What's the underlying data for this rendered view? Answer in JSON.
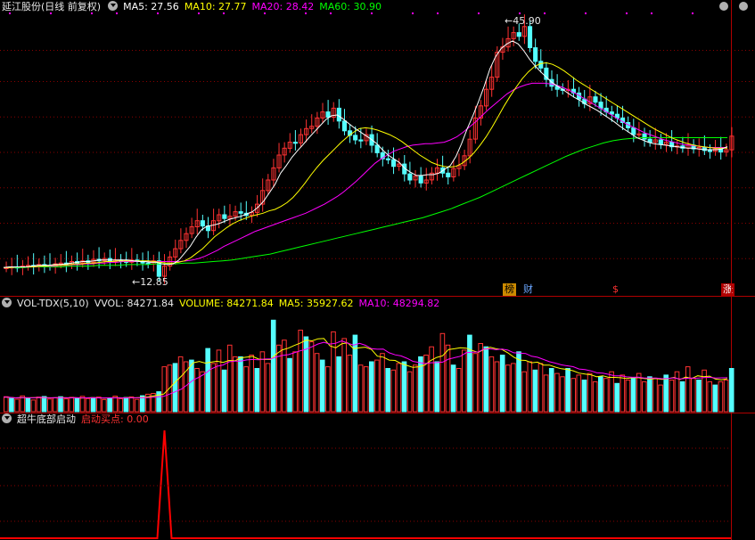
{
  "main": {
    "stock_title": "延江股份(日线 前复权)",
    "ma5_label": "MA5: 27.56",
    "ma10_label": "MA10: 27.77",
    "ma20_label": "MA20: 28.42",
    "ma60_label": "MA60: 30.90",
    "high_label": "45.90",
    "low_label": "12.85",
    "markers": [
      "榜",
      "财",
      "$",
      "涨"
    ]
  },
  "volume": {
    "indicator_label": "VOL-TDX(5,10)",
    "vvol_label": "VVOL: 84271.84",
    "volume_label": "VOLUME: 84271.84",
    "ma5_label": "MA5: 35927.62",
    "ma10_label": "MA10: 48294.82"
  },
  "signal": {
    "indicator_label": "超牛底部启动",
    "value_label": "启动买点: 0.00"
  },
  "colors": {
    "up": "#ff3232",
    "down": "#54ffff",
    "ma5": "#ffffff",
    "ma10": "#ffff00",
    "ma20": "#ff00ff",
    "ma60": "#00ff00",
    "grid": "#8b0000"
  },
  "chart_data": [
    {
      "type": "candlestick",
      "title": "延江股份(日线 前复权)",
      "price_range": [
        10.5,
        48
      ],
      "annotations": [
        {
          "label": "45.90",
          "value": 45.9
        },
        {
          "label": "12.85",
          "value": 12.85
        }
      ],
      "close": [
        14.0,
        14.1,
        14.0,
        14.2,
        14.3,
        14.1,
        14.4,
        14.3,
        14.2,
        14.5,
        14.6,
        14.4,
        14.8,
        14.6,
        14.9,
        14.7,
        15.1,
        14.9,
        15.2,
        14.8,
        15.0,
        14.9,
        14.7,
        15.0,
        14.8,
        14.6,
        14.5,
        14.9,
        12.85,
        14.2,
        15.4,
        16.5,
        17.6,
        18.5,
        19.4,
        20.2,
        19.5,
        18.9,
        20.2,
        21.0,
        20.5,
        20.8,
        21.4,
        21.2,
        20.9,
        21.3,
        22.4,
        24.2,
        25.6,
        27.2,
        28.9,
        29.8,
        30.6,
        30.5,
        31.6,
        32.4,
        32.7,
        33.8,
        34.6,
        33.9,
        35.1,
        33.4,
        32.1,
        31.5,
        30.9,
        30.8,
        31.6,
        30.2,
        29.2,
        28.4,
        28.3,
        27.4,
        27.7,
        26.4,
        25.6,
        26.1,
        25.2,
        25.6,
        26.5,
        27.2,
        26.5,
        26.0,
        27.1,
        27.5,
        28.8,
        31.0,
        33.8,
        35.4,
        37.6,
        39.2,
        42.5,
        43.2,
        44.3,
        45.1,
        44.6,
        45.9,
        43.1,
        41.3,
        40.4,
        38.9,
        38.0,
        37.6,
        37.5,
        37.6,
        37.1,
        36.3,
        35.7,
        36.6,
        35.9,
        35.1,
        34.6,
        34.3,
        33.8,
        33.2,
        32.5,
        31.6,
        31.7,
        31.0,
        30.6,
        30.9,
        30.3,
        30.6,
        30.0,
        30.1,
        29.8,
        30.2,
        29.7,
        29.9,
        29.5,
        29.4,
        29.7,
        29.3,
        29.6,
        31.4
      ],
      "ma5": [
        14.0,
        14.1,
        14.1,
        14.1,
        14.1,
        14.2,
        14.3,
        14.3,
        14.3,
        14.4,
        14.4,
        14.5,
        14.6,
        14.7,
        14.8,
        14.8,
        14.9,
        15.0,
        15.0,
        15.0,
        15.0,
        15.0,
        15.0,
        14.9,
        14.8,
        14.8,
        14.7,
        14.7,
        14.5,
        14.4,
        14.5,
        15.0,
        15.9,
        16.8,
        18.0,
        19.0,
        19.5,
        19.6,
        19.8,
        20.1,
        20.4,
        20.6,
        20.8,
        21.1,
        21.4,
        22.0,
        22.8,
        23.9,
        25.0,
        26.5,
        27.5,
        28.6,
        29.5,
        30.3,
        31.2,
        32.0,
        32.8,
        33.6,
        34.1,
        34.2,
        33.7,
        33.1,
        32.5,
        32.0,
        31.5,
        31.0,
        30.4,
        29.6,
        28.9,
        28.4,
        27.9,
        27.1,
        26.6,
        26.2,
        26.2,
        26.3,
        26.3,
        26.5,
        27.0,
        27.5,
        28.7,
        30.4,
        32.4,
        34.1,
        36.0,
        38.0,
        40.3,
        41.9,
        43.0,
        43.6,
        44.0,
        43.6,
        42.7,
        41.6,
        40.7,
        39.9,
        39.2,
        38.5,
        38.0,
        37.5,
        37.0,
        36.5,
        36.1,
        35.6,
        35.2,
        34.8,
        34.3,
        33.8,
        33.3,
        32.7,
        32.2,
        31.7,
        31.2,
        30.9,
        30.6,
        30.4,
        30.3,
        30.2,
        30.1,
        30.0,
        29.9,
        29.8,
        29.8,
        29.7,
        29.6,
        29.6,
        29.6,
        29.7,
        30.0
      ],
      "ma10": [
        14.0,
        14.0,
        14.1,
        14.1,
        14.1,
        14.1,
        14.2,
        14.2,
        14.3,
        14.3,
        14.3,
        14.4,
        14.5,
        14.5,
        14.6,
        14.6,
        14.7,
        14.8,
        14.8,
        14.9,
        14.9,
        14.9,
        14.9,
        14.9,
        14.9,
        14.8,
        14.7,
        14.6,
        14.6,
        14.7,
        14.9,
        15.3,
        15.9,
        16.5,
        17.3,
        18.1,
        18.7,
        19.3,
        19.8,
        20.2,
        20.5,
        20.8,
        21.0,
        21.2,
        21.5,
        21.7,
        22.1,
        22.6,
        23.3,
        24.2,
        25.2,
        26.3,
        27.3,
        28.2,
        29.0,
        29.8,
        30.6,
        31.3,
        31.9,
        32.4,
        32.5,
        32.4,
        32.2,
        31.9,
        31.6,
        31.2,
        30.7,
        30.1,
        29.5,
        28.9,
        28.4,
        27.9,
        27.6,
        27.4,
        27.3,
        27.4,
        27.8,
        28.4,
        29.2,
        30.2,
        31.3,
        32.6,
        34.0,
        35.4,
        36.7,
        37.9,
        39.0,
        39.9,
        40.6,
        41.0,
        41.1,
        40.9,
        40.5,
        40.0,
        39.4,
        38.8,
        38.3,
        37.8,
        37.3,
        36.8,
        36.3,
        35.8,
        35.3,
        34.8,
        34.3,
        33.8,
        33.3,
        32.8,
        32.3,
        31.9,
        31.5,
        31.1,
        30.8,
        30.5,
        30.3,
        30.1,
        30.0,
        29.9,
        29.8,
        29.8,
        29.8
      ],
      "ma20": [
        14.0,
        14.0,
        14.1,
        14.1,
        14.1,
        14.1,
        14.2,
        14.2,
        14.2,
        14.3,
        14.3,
        14.4,
        14.4,
        14.5,
        14.5,
        14.6,
        14.6,
        14.7,
        14.7,
        14.8,
        14.8,
        14.8,
        14.8,
        14.8,
        14.8,
        14.8,
        14.8,
        14.8,
        14.8,
        14.9,
        15.0,
        15.2,
        15.5,
        15.9,
        16.3,
        16.8,
        17.2,
        17.6,
        18.0,
        18.4,
        18.8,
        19.1,
        19.4,
        19.7,
        20.0,
        20.3,
        20.6,
        20.9,
        21.2,
        21.6,
        22.0,
        22.4,
        22.9,
        23.4,
        24.0,
        24.7,
        25.4,
        26.2,
        27.0,
        27.8,
        28.4,
        28.9,
        29.4,
        29.7,
        30.0,
        30.2,
        30.3,
        30.4,
        30.4,
        30.5,
        30.6,
        30.9,
        31.3,
        31.9,
        32.6,
        33.3,
        34.1,
        34.9,
        35.6,
        36.3,
        37.0,
        37.5,
        37.9,
        38.2,
        38.4,
        38.4,
        38.4,
        38.3,
        38.1,
        37.8,
        37.4,
        37.0,
        36.5,
        36.0,
        35.5,
        35.0,
        34.5,
        34.0,
        33.5,
        33.0,
        32.6,
        32.2,
        31.8,
        31.5,
        31.2,
        30.9,
        30.7,
        30.5,
        30.3,
        30.2,
        30.1,
        30.0,
        29.9,
        29.9,
        29.9,
        29.9
      ],
      "ma60": [
        14.0,
        14.0,
        14.0,
        14.1,
        14.1,
        14.1,
        14.1,
        14.2,
        14.2,
        14.2,
        14.3,
        14.3,
        14.3,
        14.4,
        14.4,
        14.4,
        14.5,
        14.5,
        14.5,
        14.6,
        14.6,
        14.7,
        14.8,
        14.9,
        15.0,
        15.2,
        15.4,
        15.6,
        15.8,
        16.1,
        16.4,
        16.7,
        17.0,
        17.3,
        17.6,
        17.9,
        18.2,
        18.5,
        18.8,
        19.1,
        19.4,
        19.7,
        20.0,
        20.3,
        20.6,
        21.0,
        21.4,
        21.8,
        22.3,
        22.8,
        23.3,
        23.9,
        24.5,
        25.1,
        25.7,
        26.3,
        26.9,
        27.5,
        28.1,
        28.7,
        29.2,
        29.7,
        30.1,
        30.5,
        30.8,
        31.0,
        31.1,
        31.2,
        31.2,
        31.2,
        31.2,
        31.2,
        31.2,
        31.2,
        31.2,
        31.2,
        31.2
      ]
    },
    {
      "type": "bar",
      "title": "VOL-TDX(5,10)",
      "series": [
        {
          "name": "VOLUME"
        },
        {
          "name": "MA5"
        },
        {
          "name": "MA10"
        }
      ],
      "volume": [
        9000,
        8000,
        7500,
        9500,
        8200,
        7000,
        8800,
        9100,
        7600,
        8300,
        9000,
        7700,
        8600,
        8100,
        9200,
        7900,
        8400,
        8800,
        7300,
        8000,
        9300,
        7800,
        8500,
        8900,
        7400,
        9600,
        10500,
        11000,
        12000,
        27000,
        28000,
        29000,
        33000,
        30000,
        31000,
        26000,
        24000,
        38000,
        29000,
        37000,
        25000,
        40000,
        33000,
        33000,
        27000,
        34000,
        26000,
        36000,
        29000,
        55000,
        40000,
        43000,
        32000,
        36000,
        49000,
        45000,
        42000,
        35000,
        31000,
        27000,
        48000,
        33000,
        44000,
        34000,
        46000,
        28000,
        27000,
        30000,
        31000,
        35000,
        26000,
        25000,
        29000,
        30000,
        24000,
        28000,
        33000,
        34000,
        39000,
        30000,
        47000,
        40000,
        28000,
        26000,
        37000,
        46000,
        35000,
        41000,
        39000,
        33000,
        30000,
        34000,
        28000,
        29000,
        36000,
        24000,
        30000,
        25000,
        29000,
        22000,
        26000,
        23000,
        21000,
        26000,
        20000,
        22000,
        19000,
        23000,
        18000,
        21000,
        20000,
        24000,
        17000,
        22000,
        19000,
        20000,
        23000,
        18000,
        21000,
        20000,
        16000,
        22000,
        19000,
        24000,
        18000,
        27000,
        20000,
        19000,
        25000,
        18000,
        16000,
        18000,
        19000,
        26000
      ],
      "ma5": [
        8800,
        8600,
        8300,
        8400,
        8300,
        8400,
        8500,
        8400,
        8300,
        8400,
        8400,
        8300,
        8400,
        8200,
        8300,
        8400,
        8300,
        8200,
        8300,
        8400,
        8300,
        8400,
        8300,
        8500,
        8700,
        9200,
        9900,
        10600,
        14300,
        18000,
        21500,
        25400,
        29400,
        30200,
        29200,
        29800,
        30300,
        29600,
        30800,
        30600,
        32400,
        32800,
        33200,
        31600,
        31400,
        31400,
        34800,
        37200,
        38200,
        39800,
        41200,
        43000,
        42600,
        43800,
        44000,
        39600,
        38400,
        40800,
        41400,
        37800,
        38400,
        38800,
        37400,
        33400,
        32800,
        31000,
        30800,
        29000,
        27800,
        26600,
        27000,
        28000,
        30800,
        32600,
        33600,
        37400,
        37800,
        38400,
        38200,
        36800,
        35600,
        37400,
        38800,
        37800,
        37400,
        35400,
        32800,
        31000,
        30800,
        29400,
        29800,
        28000,
        28000,
        26800,
        25800,
        25400,
        24600,
        23200,
        22600,
        22200,
        21000,
        21600,
        20600,
        20600,
        20400,
        20000,
        20400,
        20400,
        20000,
        19600,
        20000,
        19400,
        19800,
        20600,
        19400,
        20800,
        20000,
        21600,
        21000,
        21400,
        19600,
        19200,
        19800
      ]
    },
    {
      "type": "line",
      "title": "超牛底部启动",
      "series": [
        {
          "name": "启动买点"
        }
      ],
      "signal_index": 29,
      "signal_value": 1
    }
  ]
}
